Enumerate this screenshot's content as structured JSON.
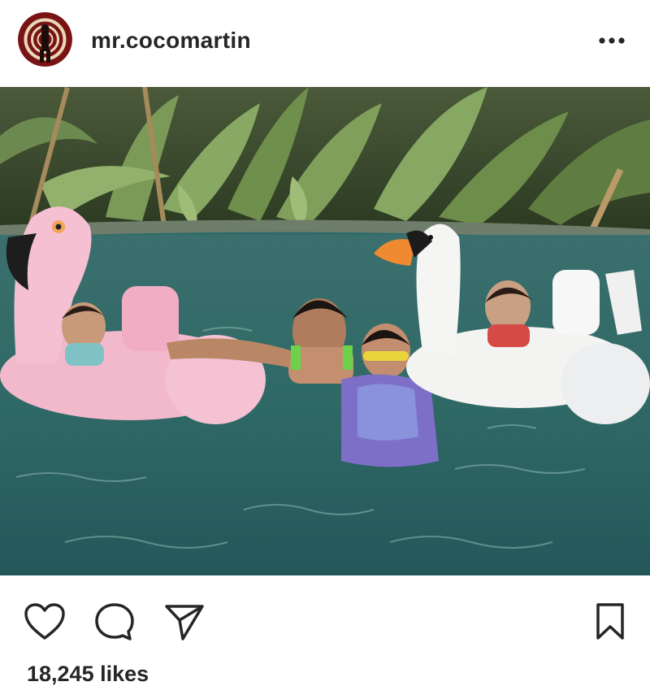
{
  "post": {
    "username": "mr.cocomartin",
    "likes_text": "18,245 likes"
  },
  "icons": {
    "more": "more-horizontal-icon",
    "like": "heart-icon",
    "comment": "comment-icon",
    "share": "send-icon",
    "save": "bookmark-icon"
  },
  "colors": {
    "text": "#262626",
    "background": "#ffffff"
  }
}
